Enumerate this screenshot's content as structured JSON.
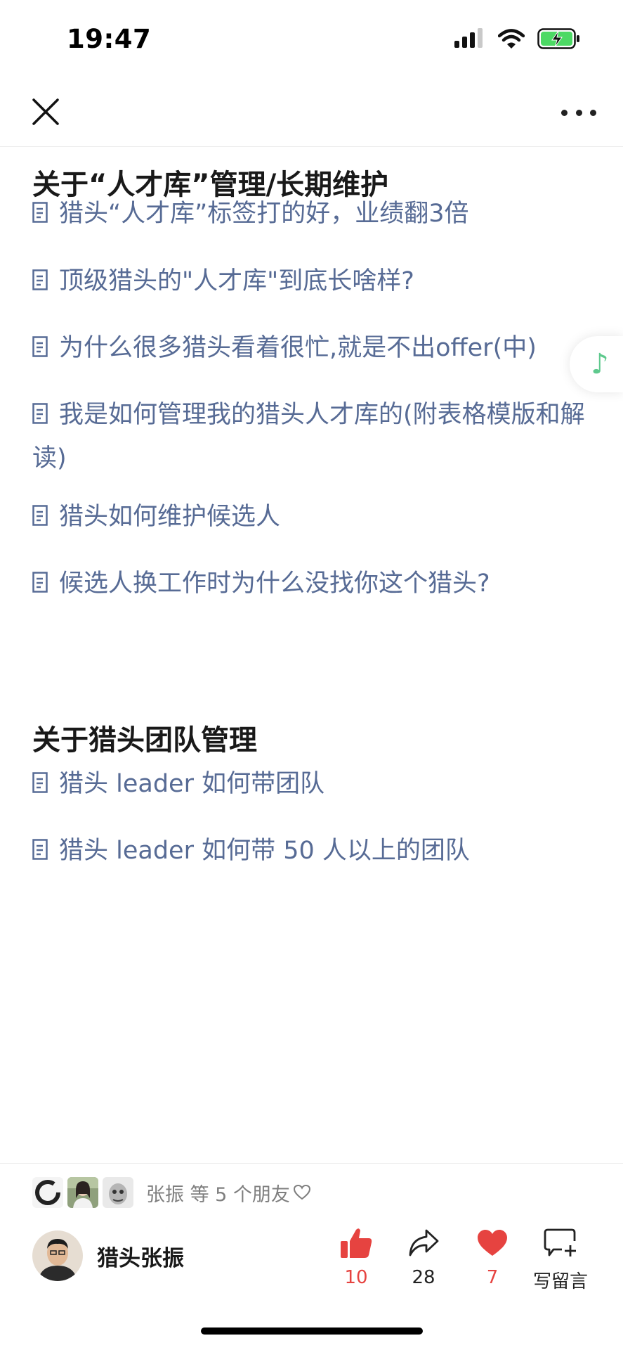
{
  "status_bar": {
    "time": "19:47"
  },
  "nav": {
    "close_icon": "close-icon",
    "more_icon": "more-icon"
  },
  "section1": {
    "title": "关于“人才库”管理/长期维护",
    "links": [
      "猎头“人才库”标签打的好，业绩翻3倍",
      "顶级猎头的\"人才库\"到底长啥样?",
      "为什么很多猎头看着很忙,就是不出offer(中)",
      "我是如何管理我的猎头人才库的(附表格模版和解读)",
      "猎头如何维护候选人",
      "候选人换工作时为什么没找你这个猎头?"
    ]
  },
  "section2": {
    "title": "关于猎头团队管理",
    "links": [
      "猎头 leader 如何带团队",
      "猎头 leader 如何带 50 人以上的团队"
    ]
  },
  "footer": {
    "friends_text": "张振 等 5 个朋友",
    "author_name": "猎头张振",
    "like_count": "10",
    "share_count": "28",
    "wow_count": "7",
    "comment_label": "写留言"
  },
  "colors": {
    "link": "#576b95",
    "like_red": "#e64340",
    "music_green": "#5ec98d"
  }
}
